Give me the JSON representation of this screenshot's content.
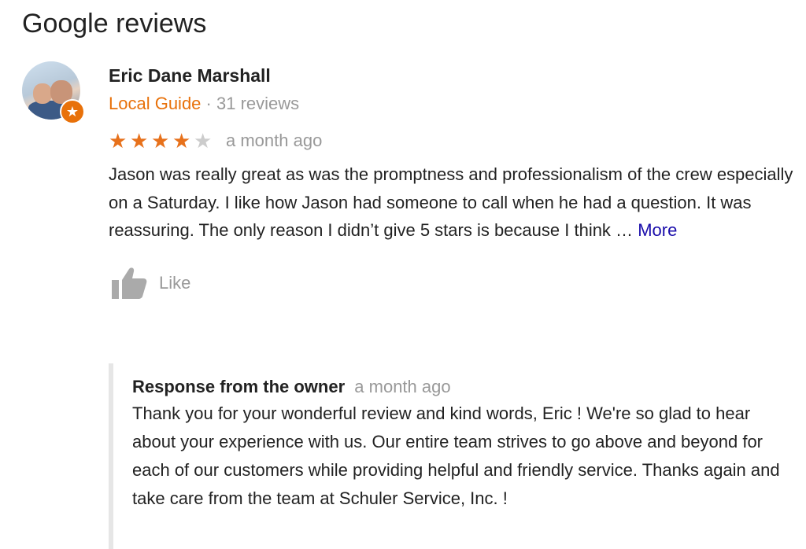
{
  "section": {
    "title": "Google reviews"
  },
  "review": {
    "author": "Eric Dane Marshall",
    "badge": "Local Guide",
    "separator": "·",
    "review_count": "31 reviews",
    "rating": 4,
    "rating_max": 5,
    "time": "a month ago",
    "text": "Jason was really great as was the promptness and professionalism of the crew especially on a Saturday. I like how Jason had someone to call when he had a question. It was reassuring. The only reason I didn’t give 5 stars is because I think …",
    "more_label": "More",
    "like_label": "Like"
  },
  "owner_response": {
    "title": "Response from the owner",
    "time": "a month ago",
    "text": "Thank you for your wonderful review and kind words, Eric ! We're so glad to hear about your experience with us. Our entire team strives to go above and beyond for each of our customers while providing helpful and friendly service. Thanks again and take care from the team at Schuler Service, Inc. !"
  },
  "colors": {
    "accent_orange": "#e8710a",
    "star_on": "#e7711b",
    "star_off": "#cccccc",
    "link": "#1a0dab",
    "muted": "#999999",
    "response_border": "#e6e6e6"
  },
  "icons": {
    "star": "star-icon",
    "like": "thumbs-up-icon",
    "local_guide": "local-guide-star-icon"
  }
}
